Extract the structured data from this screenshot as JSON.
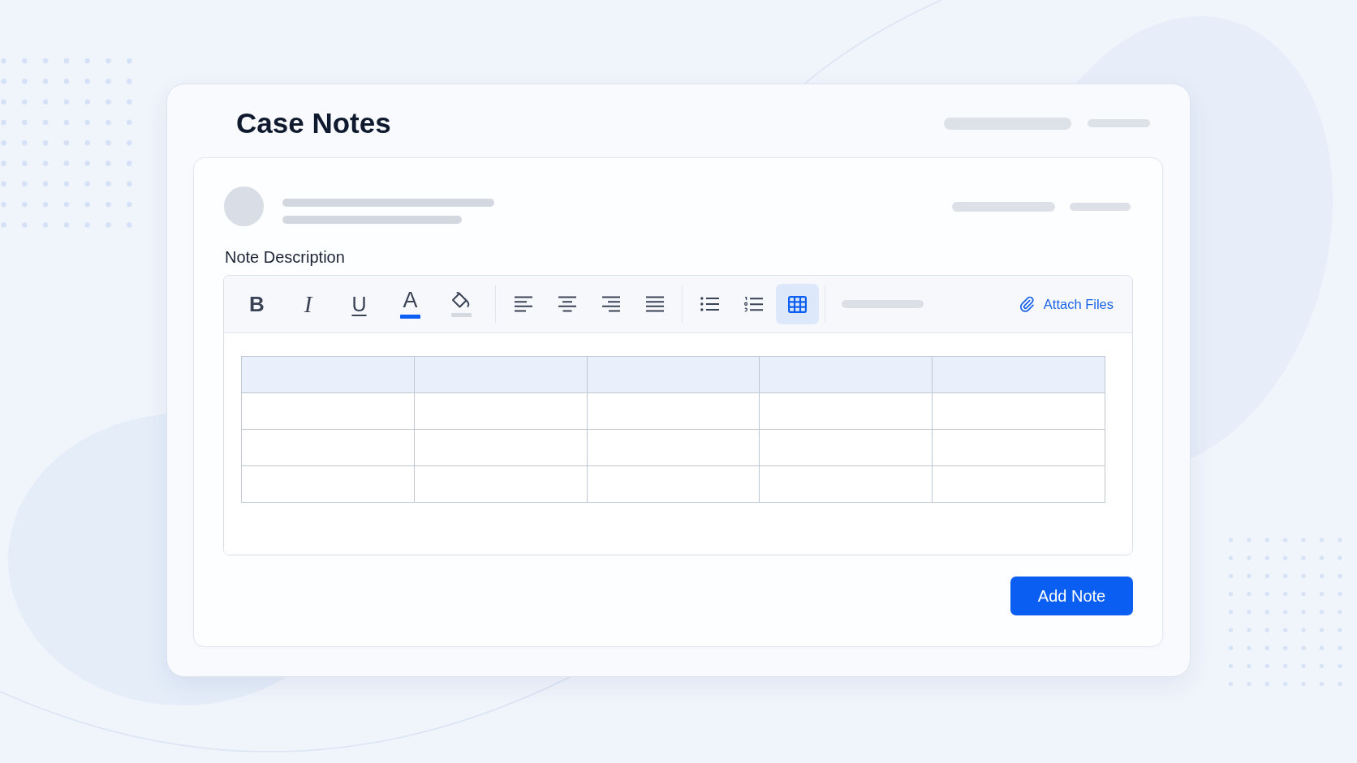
{
  "page": {
    "title": "Case Notes"
  },
  "note_form": {
    "field_label": "Note Description",
    "toolbar": {
      "groups": [
        {
          "buttons": [
            {
              "kind": "bold",
              "label": "B",
              "selected": false
            },
            {
              "kind": "italic",
              "label": "I",
              "selected": false
            },
            {
              "kind": "underline",
              "label": "U",
              "selected": false
            },
            {
              "kind": "text-color",
              "label": "A",
              "color": "#0d5ef2",
              "selected": false
            },
            {
              "kind": "highlight",
              "color": "#d5d9e0",
              "selected": false
            }
          ]
        },
        {
          "buttons": [
            {
              "kind": "align-left",
              "selected": false
            },
            {
              "kind": "align-center",
              "selected": false
            },
            {
              "kind": "align-right",
              "selected": false
            },
            {
              "kind": "justify",
              "selected": false
            }
          ]
        },
        {
          "buttons": [
            {
              "kind": "bullet-list",
              "selected": false
            },
            {
              "kind": "numbered-list",
              "selected": false
            },
            {
              "kind": "table",
              "selected": true
            }
          ]
        }
      ],
      "attach": {
        "label": "Attach Files"
      }
    },
    "submit": {
      "label": "Add Note"
    }
  }
}
